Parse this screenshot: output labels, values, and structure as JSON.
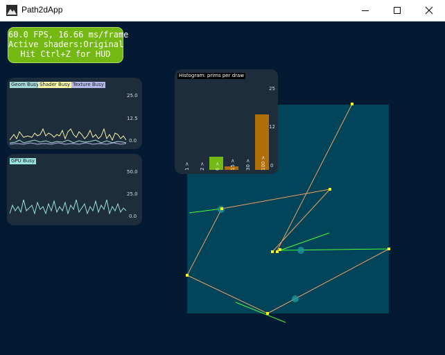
{
  "window": {
    "title": "Path2dApp",
    "icons": {
      "app": "mountain-app-icon",
      "minimize": "minimize-icon",
      "maximize": "maximize-icon",
      "close": "close-icon"
    }
  },
  "hud": {
    "line1": "60.0 FPS, 16.66 ms/frame",
    "line2": "Active shaders:Original",
    "line3": "Hit Ctrl+Z for HUD",
    "color": "#74b814"
  },
  "geom_panel": {
    "tags": {
      "geom": "Geom Busy",
      "shader": "Shader Busy",
      "texture": "Texture Busy"
    },
    "ticks": [
      "25.0",
      "12.5",
      "0.0"
    ],
    "colors": {
      "geom": "#a7d9d4",
      "shader": "#fbf5a7",
      "texture": "#b8b8e8"
    }
  },
  "gpu_panel": {
    "tag": "GPU Busy",
    "ticks": [
      "50.0",
      "25.0",
      "0.0"
    ],
    "color": "#9be3dd"
  },
  "histogram": {
    "title": "Histogram: prims per draw",
    "ticks": [
      "25",
      "12",
      "0"
    ],
    "bins": [
      {
        "label": "1 >",
        "value": 0
      },
      {
        "label": "2 >",
        "value": 4
      },
      {
        "label": "6 >",
        "value": 1
      },
      {
        "label": "15 >",
        "value": 0
      },
      {
        "label": "30 >",
        "value": 17
      },
      {
        "label": "100 >",
        "value": 0
      }
    ],
    "max": 25,
    "colors": {
      "highlight": "#74b814",
      "normal": "#b06e0a"
    }
  },
  "scene": {
    "background": "#024459",
    "path_color": "#f0a060",
    "tangent_color": "#44ff33",
    "point_color": "#ffff00",
    "handle_color": "#1b9a9a"
  }
}
